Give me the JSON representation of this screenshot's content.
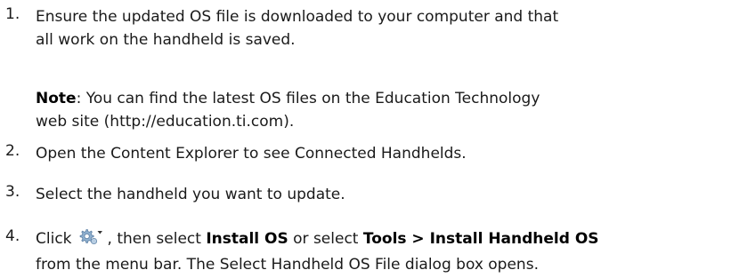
{
  "steps": [
    {
      "number": "1.",
      "lines": [
        "Ensure the updated OS file is downloaded to your computer and that",
        "all work on the handheld is saved."
      ]
    },
    {
      "note_label": "Note",
      "note_lines": [
        ": You can find the latest OS files on the Education Technology",
        "web site (http://education.ti.com)."
      ]
    },
    {
      "number": "2.",
      "text": "Open the Content Explorer to see Connected Handhelds."
    },
    {
      "number": "3.",
      "text": "Select the handheld you want to update."
    },
    {
      "number": "4.",
      "click_text": "Click",
      "icon": "gear-dropdown-icon",
      "after_icon": ", then select ",
      "install_os": "Install OS",
      "or_select": " or select ",
      "tools_path": "Tools > Install Handheld OS",
      "line2": "from the menu bar. The Select Handheld OS File dialog box opens."
    }
  ]
}
